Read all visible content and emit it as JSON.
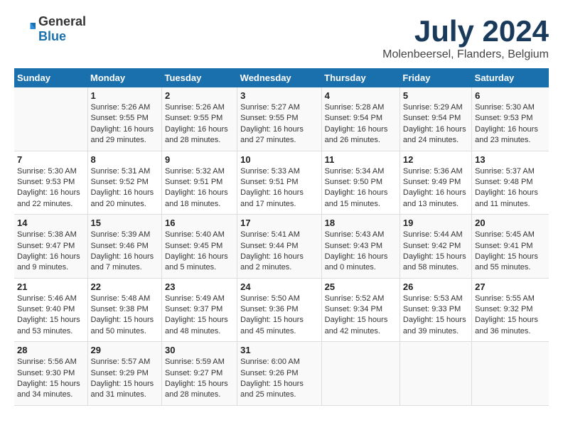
{
  "header": {
    "logo_general": "General",
    "logo_blue": "Blue",
    "title": "July 2024",
    "subtitle": "Molenbeersel, Flanders, Belgium"
  },
  "days_of_week": [
    "Sunday",
    "Monday",
    "Tuesday",
    "Wednesday",
    "Thursday",
    "Friday",
    "Saturday"
  ],
  "weeks": [
    [
      {
        "day": "",
        "sunrise": "",
        "sunset": "",
        "daylight": ""
      },
      {
        "day": "1",
        "sunrise": "Sunrise: 5:26 AM",
        "sunset": "Sunset: 9:55 PM",
        "daylight": "Daylight: 16 hours and 29 minutes."
      },
      {
        "day": "2",
        "sunrise": "Sunrise: 5:26 AM",
        "sunset": "Sunset: 9:55 PM",
        "daylight": "Daylight: 16 hours and 28 minutes."
      },
      {
        "day": "3",
        "sunrise": "Sunrise: 5:27 AM",
        "sunset": "Sunset: 9:55 PM",
        "daylight": "Daylight: 16 hours and 27 minutes."
      },
      {
        "day": "4",
        "sunrise": "Sunrise: 5:28 AM",
        "sunset": "Sunset: 9:54 PM",
        "daylight": "Daylight: 16 hours and 26 minutes."
      },
      {
        "day": "5",
        "sunrise": "Sunrise: 5:29 AM",
        "sunset": "Sunset: 9:54 PM",
        "daylight": "Daylight: 16 hours and 24 minutes."
      },
      {
        "day": "6",
        "sunrise": "Sunrise: 5:30 AM",
        "sunset": "Sunset: 9:53 PM",
        "daylight": "Daylight: 16 hours and 23 minutes."
      }
    ],
    [
      {
        "day": "7",
        "sunrise": "Sunrise: 5:30 AM",
        "sunset": "Sunset: 9:53 PM",
        "daylight": "Daylight: 16 hours and 22 minutes."
      },
      {
        "day": "8",
        "sunrise": "Sunrise: 5:31 AM",
        "sunset": "Sunset: 9:52 PM",
        "daylight": "Daylight: 16 hours and 20 minutes."
      },
      {
        "day": "9",
        "sunrise": "Sunrise: 5:32 AM",
        "sunset": "Sunset: 9:51 PM",
        "daylight": "Daylight: 16 hours and 18 minutes."
      },
      {
        "day": "10",
        "sunrise": "Sunrise: 5:33 AM",
        "sunset": "Sunset: 9:51 PM",
        "daylight": "Daylight: 16 hours and 17 minutes."
      },
      {
        "day": "11",
        "sunrise": "Sunrise: 5:34 AM",
        "sunset": "Sunset: 9:50 PM",
        "daylight": "Daylight: 16 hours and 15 minutes."
      },
      {
        "day": "12",
        "sunrise": "Sunrise: 5:36 AM",
        "sunset": "Sunset: 9:49 PM",
        "daylight": "Daylight: 16 hours and 13 minutes."
      },
      {
        "day": "13",
        "sunrise": "Sunrise: 5:37 AM",
        "sunset": "Sunset: 9:48 PM",
        "daylight": "Daylight: 16 hours and 11 minutes."
      }
    ],
    [
      {
        "day": "14",
        "sunrise": "Sunrise: 5:38 AM",
        "sunset": "Sunset: 9:47 PM",
        "daylight": "Daylight: 16 hours and 9 minutes."
      },
      {
        "day": "15",
        "sunrise": "Sunrise: 5:39 AM",
        "sunset": "Sunset: 9:46 PM",
        "daylight": "Daylight: 16 hours and 7 minutes."
      },
      {
        "day": "16",
        "sunrise": "Sunrise: 5:40 AM",
        "sunset": "Sunset: 9:45 PM",
        "daylight": "Daylight: 16 hours and 5 minutes."
      },
      {
        "day": "17",
        "sunrise": "Sunrise: 5:41 AM",
        "sunset": "Sunset: 9:44 PM",
        "daylight": "Daylight: 16 hours and 2 minutes."
      },
      {
        "day": "18",
        "sunrise": "Sunrise: 5:43 AM",
        "sunset": "Sunset: 9:43 PM",
        "daylight": "Daylight: 16 hours and 0 minutes."
      },
      {
        "day": "19",
        "sunrise": "Sunrise: 5:44 AM",
        "sunset": "Sunset: 9:42 PM",
        "daylight": "Daylight: 15 hours and 58 minutes."
      },
      {
        "day": "20",
        "sunrise": "Sunrise: 5:45 AM",
        "sunset": "Sunset: 9:41 PM",
        "daylight": "Daylight: 15 hours and 55 minutes."
      }
    ],
    [
      {
        "day": "21",
        "sunrise": "Sunrise: 5:46 AM",
        "sunset": "Sunset: 9:40 PM",
        "daylight": "Daylight: 15 hours and 53 minutes."
      },
      {
        "day": "22",
        "sunrise": "Sunrise: 5:48 AM",
        "sunset": "Sunset: 9:38 PM",
        "daylight": "Daylight: 15 hours and 50 minutes."
      },
      {
        "day": "23",
        "sunrise": "Sunrise: 5:49 AM",
        "sunset": "Sunset: 9:37 PM",
        "daylight": "Daylight: 15 hours and 48 minutes."
      },
      {
        "day": "24",
        "sunrise": "Sunrise: 5:50 AM",
        "sunset": "Sunset: 9:36 PM",
        "daylight": "Daylight: 15 hours and 45 minutes."
      },
      {
        "day": "25",
        "sunrise": "Sunrise: 5:52 AM",
        "sunset": "Sunset: 9:34 PM",
        "daylight": "Daylight: 15 hours and 42 minutes."
      },
      {
        "day": "26",
        "sunrise": "Sunrise: 5:53 AM",
        "sunset": "Sunset: 9:33 PM",
        "daylight": "Daylight: 15 hours and 39 minutes."
      },
      {
        "day": "27",
        "sunrise": "Sunrise: 5:55 AM",
        "sunset": "Sunset: 9:32 PM",
        "daylight": "Daylight: 15 hours and 36 minutes."
      }
    ],
    [
      {
        "day": "28",
        "sunrise": "Sunrise: 5:56 AM",
        "sunset": "Sunset: 9:30 PM",
        "daylight": "Daylight: 15 hours and 34 minutes."
      },
      {
        "day": "29",
        "sunrise": "Sunrise: 5:57 AM",
        "sunset": "Sunset: 9:29 PM",
        "daylight": "Daylight: 15 hours and 31 minutes."
      },
      {
        "day": "30",
        "sunrise": "Sunrise: 5:59 AM",
        "sunset": "Sunset: 9:27 PM",
        "daylight": "Daylight: 15 hours and 28 minutes."
      },
      {
        "day": "31",
        "sunrise": "Sunrise: 6:00 AM",
        "sunset": "Sunset: 9:26 PM",
        "daylight": "Daylight: 15 hours and 25 minutes."
      },
      {
        "day": "",
        "sunrise": "",
        "sunset": "",
        "daylight": ""
      },
      {
        "day": "",
        "sunrise": "",
        "sunset": "",
        "daylight": ""
      },
      {
        "day": "",
        "sunrise": "",
        "sunset": "",
        "daylight": ""
      }
    ]
  ]
}
